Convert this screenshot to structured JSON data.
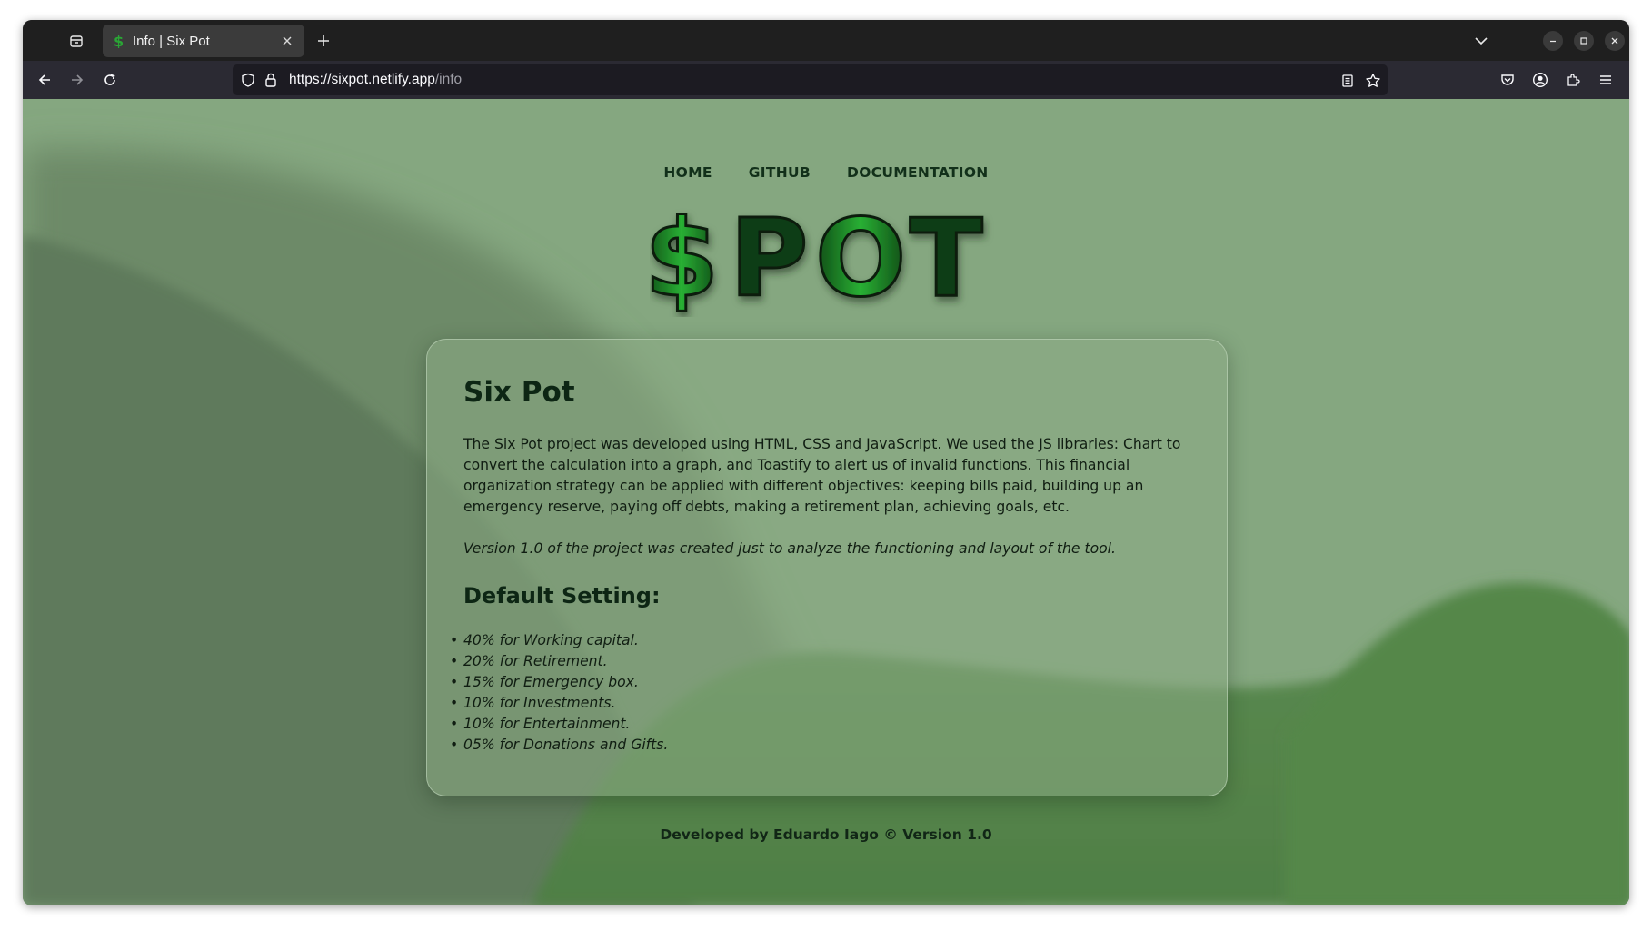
{
  "browser": {
    "tab_title": "Info | Six Pot",
    "url_host": "https://sixpot.netlify.app",
    "url_path": "/info"
  },
  "nav": {
    "items": [
      "HOME",
      "GITHUB",
      "DOCUMENTATION"
    ]
  },
  "logo": {
    "text_dollar": "$",
    "text_p": "P",
    "text_o": "O",
    "text_t": "T"
  },
  "card": {
    "title": "Six Pot",
    "description": "The Six Pot project was developed using HTML, CSS and JavaScript. We used the JS libraries: Chart to convert the calculation into a graph, and Toastify to alert us of invalid functions. This financial organization strategy can be applied with different objectives: keeping bills paid, building up an emergency reserve, paying off debts, making a retirement plan, achieving goals, etc.",
    "note": "Version 1.0 of the project was created just to analyze the functioning and layout of the tool.",
    "settings_title": "Default Setting:",
    "settings": [
      "40% for Working capital.",
      "20% for Retirement.",
      "15% for Emergency box.",
      "10% for Investments.",
      "10% for Entertainment.",
      "05% for Donations and Gifts."
    ]
  },
  "footer": "Developed by Eduardo Iago © Version 1.0",
  "colors": {
    "bg_light": "#82a47d",
    "bg_dark": "#5e7b5b",
    "bg_bottom": "#54884a",
    "logo_green": "#1f9f2a",
    "logo_dark": "#0c3a12"
  },
  "icons": {
    "tab_list": "tab-list-icon",
    "favicon": "dollar-favicon-icon",
    "close": "close-icon",
    "new_tab": "plus-icon",
    "back": "arrow-left-icon",
    "forward": "arrow-right-icon",
    "reload": "reload-icon",
    "shield": "shield-icon",
    "lock": "lock-icon",
    "reader": "reader-view-icon",
    "bookmark": "star-icon",
    "pocket": "pocket-icon",
    "account": "account-icon",
    "extensions": "puzzle-icon",
    "menu": "hamburger-menu-icon"
  }
}
